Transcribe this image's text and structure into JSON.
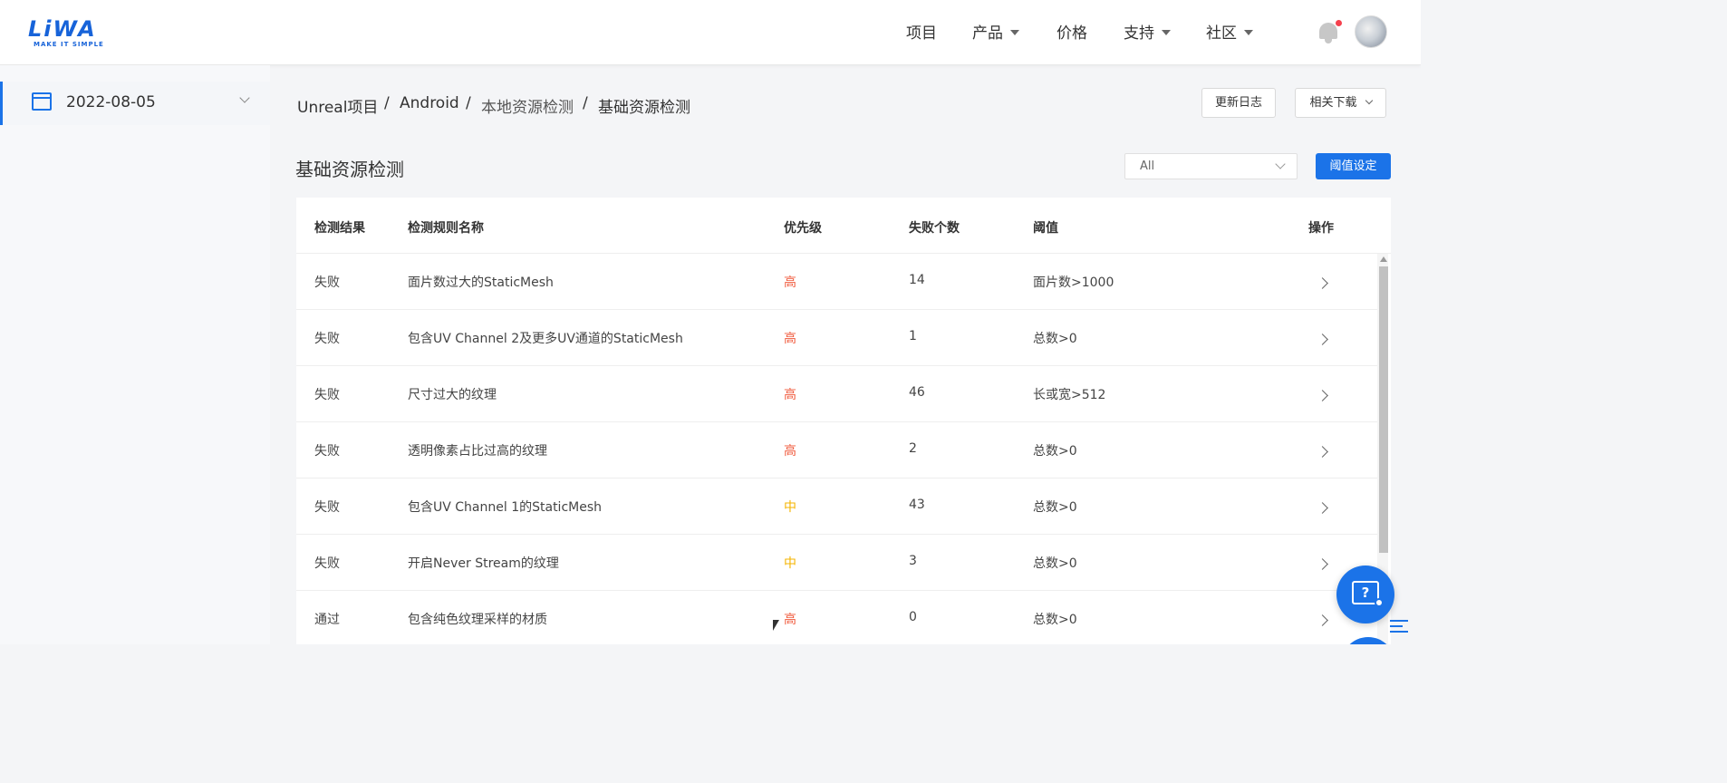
{
  "app": {
    "logo_text": "LiWA",
    "logo_subtitle": "MAKE IT SIMPLE"
  },
  "nav": {
    "items": [
      {
        "label": "项目",
        "dropdown": false
      },
      {
        "label": "产品",
        "dropdown": true
      },
      {
        "label": "价格",
        "dropdown": false
      },
      {
        "label": "支持",
        "dropdown": true
      },
      {
        "label": "社区",
        "dropdown": true
      }
    ],
    "icons": {
      "notifications": "bell-icon",
      "avatar": "avatar"
    }
  },
  "sidebar": {
    "date": "2022-08-05",
    "icons": {
      "calendar": "calendar-icon",
      "caret": "chevron-down-icon"
    }
  },
  "breadcrumb": [
    "Unreal项目",
    "Android",
    "本地资源检测",
    "基础资源检测"
  ],
  "header_buttons": {
    "changelog": "更新日志",
    "downloads": "相关下载"
  },
  "main": {
    "title": "基础资源检测",
    "filter_value": "All",
    "threshold_button": "阈值设定"
  },
  "table": {
    "columns": [
      "检测结果",
      "检测规则名称",
      "优先级",
      "失败个数",
      "阈值",
      "操作"
    ],
    "rows": [
      {
        "result": "失败",
        "rule": "面片数过大的StaticMesh",
        "priority": "高",
        "count": "14",
        "threshold": "面片数>1000"
      },
      {
        "result": "失败",
        "rule": "包含UV Channel 2及更多UV通道的StaticMesh",
        "priority": "高",
        "count": "1",
        "threshold": "总数>0"
      },
      {
        "result": "失败",
        "rule": "尺寸过大的纹理",
        "priority": "高",
        "count": "46",
        "threshold": "长或宽>512"
      },
      {
        "result": "失败",
        "rule": "透明像素占比过高的纹理",
        "priority": "高",
        "count": "2",
        "threshold": "总数>0"
      },
      {
        "result": "失败",
        "rule": "包含UV Channel 1的StaticMesh",
        "priority": "中",
        "count": "43",
        "threshold": "总数>0"
      },
      {
        "result": "失败",
        "rule": "开启Never Stream的纹理",
        "priority": "中",
        "count": "3",
        "threshold": "总数>0"
      },
      {
        "result": "通过",
        "rule": "包含纯色纹理采样的材质",
        "priority": "高",
        "count": "0",
        "threshold": "总数>0"
      }
    ]
  },
  "colors": {
    "accent": "#1b73e8",
    "priority_high": "#f05b3e",
    "priority_mid": "#f5b400"
  },
  "floating": {
    "help_glyph": "?"
  }
}
